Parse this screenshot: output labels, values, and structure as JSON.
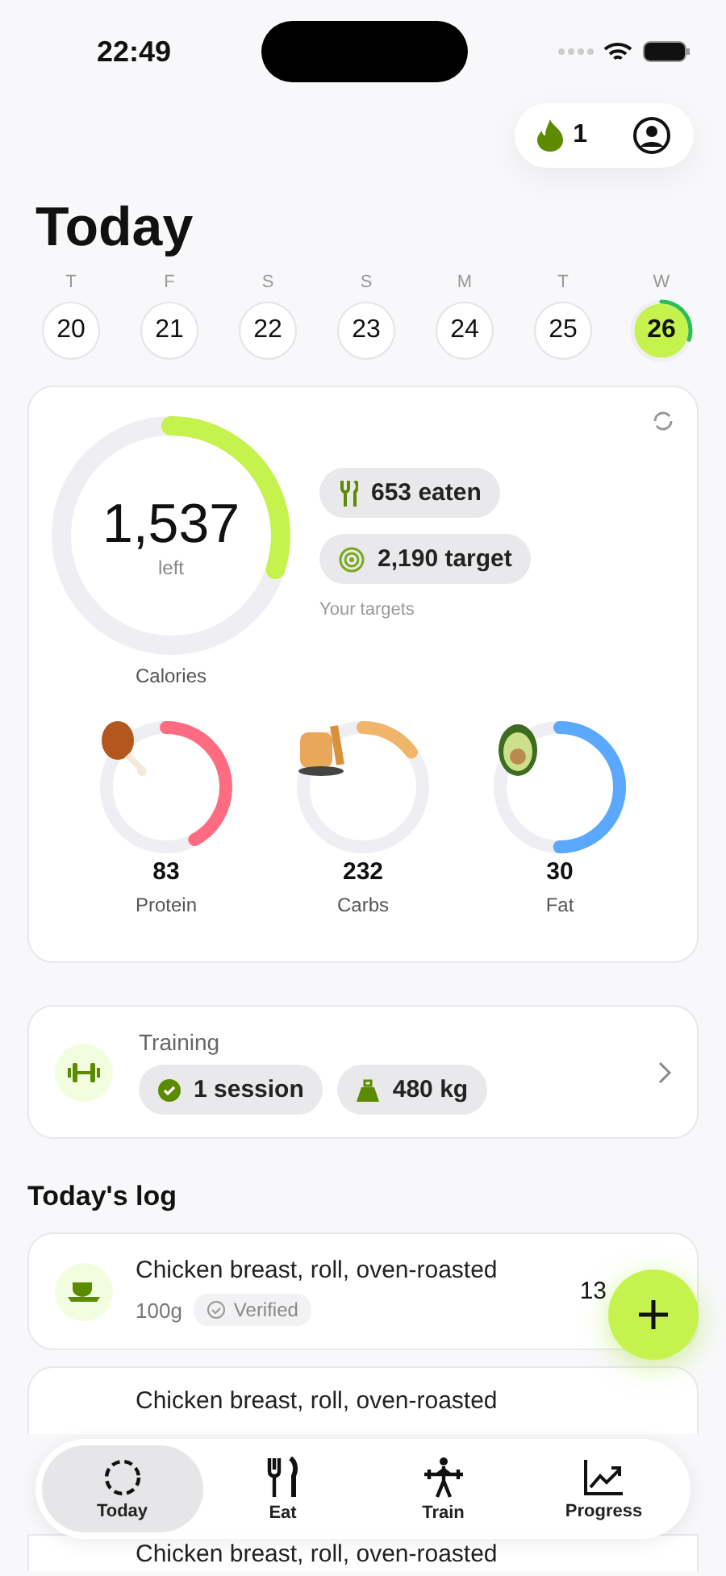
{
  "status_bar": {
    "time": "22:49"
  },
  "header": {
    "streak": "1"
  },
  "title": "Today",
  "week": [
    {
      "letter": "T",
      "number": "20",
      "selected": false
    },
    {
      "letter": "F",
      "number": "21",
      "selected": false
    },
    {
      "letter": "S",
      "number": "22",
      "selected": false
    },
    {
      "letter": "S",
      "number": "23",
      "selected": false
    },
    {
      "letter": "M",
      "number": "24",
      "selected": false
    },
    {
      "letter": "T",
      "number": "25",
      "selected": false
    },
    {
      "letter": "W",
      "number": "26",
      "selected": true,
      "level": 0.3
    }
  ],
  "calories": {
    "value": "1,537",
    "unit": "left",
    "label": "Calories",
    "level": 0.3,
    "eaten": "653 eaten",
    "target": "2,190 target",
    "targets_link": "Your targets"
  },
  "macros": [
    {
      "kind": "protein",
      "value": "83",
      "label": "Protein",
      "level": 0.42,
      "color": "#ff6b81"
    },
    {
      "kind": "carbs",
      "value": "232",
      "label": "Carbs",
      "level": 0.15,
      "color": "#f0b46a"
    },
    {
      "kind": "fat",
      "value": "30",
      "label": "Fat",
      "level": 0.5,
      "color": "#5aa8ff"
    }
  ],
  "training": {
    "title": "Training",
    "sessions": "1 session",
    "volume": "480 kg"
  },
  "log": {
    "title": "Today's log",
    "entries": [
      {
        "name": "Chicken breast, roll, oven-roasted",
        "amount": "100g",
        "badge": "Verified",
        "calories": "13"
      },
      {
        "name": "Chicken breast, roll, oven-roasted"
      },
      {
        "name": "Chicken breast, roll, oven-roasted"
      }
    ]
  },
  "nav": [
    {
      "kind": "today",
      "label": "Today",
      "selected": true
    },
    {
      "kind": "eat",
      "label": "Eat",
      "selected": false
    },
    {
      "kind": "train",
      "label": "Train",
      "selected": false
    },
    {
      "kind": "progress",
      "label": "Progress",
      "selected": false
    }
  ]
}
